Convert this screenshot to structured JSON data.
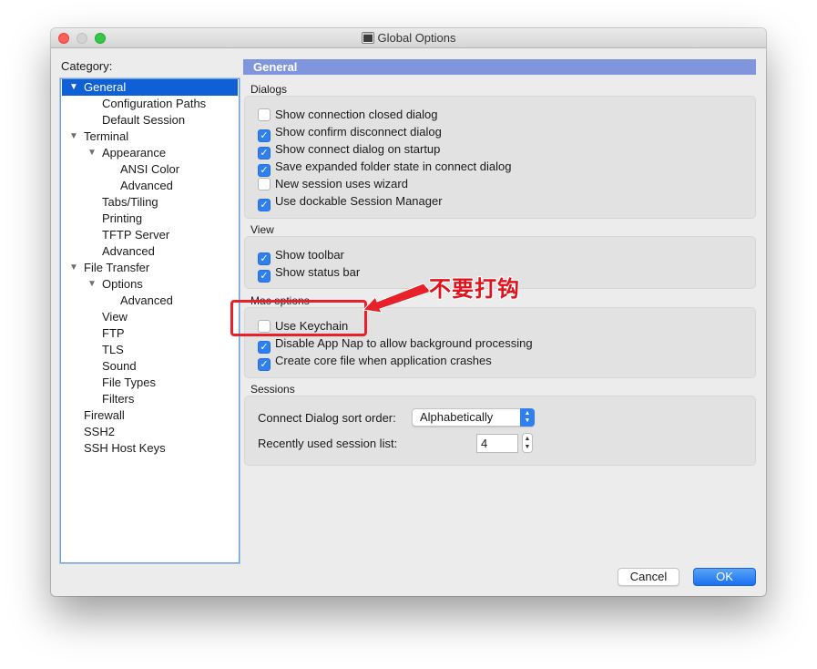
{
  "window": {
    "title": "Global Options"
  },
  "category": {
    "label": "Category:",
    "items": [
      {
        "label": "General",
        "expanded": true,
        "selected": true
      },
      {
        "label": "Configuration Paths"
      },
      {
        "label": "Default Session"
      },
      {
        "label": "Terminal",
        "expanded": true
      },
      {
        "label": "Appearance",
        "expanded": true
      },
      {
        "label": "ANSI Color"
      },
      {
        "label": "Advanced"
      },
      {
        "label": "Tabs/Tiling"
      },
      {
        "label": "Printing"
      },
      {
        "label": "TFTP Server"
      },
      {
        "label": "Advanced"
      },
      {
        "label": "File Transfer",
        "expanded": true
      },
      {
        "label": "Options",
        "expanded": true
      },
      {
        "label": "Advanced"
      },
      {
        "label": "View"
      },
      {
        "label": "FTP"
      },
      {
        "label": "TLS"
      },
      {
        "label": "Sound"
      },
      {
        "label": "File Types"
      },
      {
        "label": "Filters"
      },
      {
        "label": "Firewall"
      },
      {
        "label": "SSH2"
      },
      {
        "label": "SSH Host Keys"
      }
    ]
  },
  "content": {
    "header": "General",
    "dialogs": {
      "title": "Dialogs",
      "options": [
        {
          "label": "Show connection closed dialog",
          "checked": false
        },
        {
          "label": "Show confirm disconnect dialog",
          "checked": true
        },
        {
          "label": "Show connect dialog on startup",
          "checked": true
        },
        {
          "label": "Save expanded folder state in connect dialog",
          "checked": true
        },
        {
          "label": "New session uses wizard",
          "checked": false
        },
        {
          "label": "Use dockable Session Manager",
          "checked": true
        }
      ]
    },
    "view": {
      "title": "View",
      "options": [
        {
          "label": "Show toolbar",
          "checked": true
        },
        {
          "label": "Show status bar",
          "checked": true
        }
      ]
    },
    "mac_options": {
      "title": "Mac options",
      "options": [
        {
          "label": "Use Keychain",
          "checked": false
        },
        {
          "label": "Disable App Nap to allow background processing",
          "checked": true
        },
        {
          "label": "Create core file when application crashes",
          "checked": true
        }
      ]
    },
    "sessions": {
      "title": "Sessions",
      "sort_label": "Connect Dialog sort order:",
      "sort_value": "Alphabetically",
      "recent_label": "Recently used session list:",
      "recent_value": "4"
    }
  },
  "buttons": {
    "cancel": "Cancel",
    "ok": "OK"
  },
  "annotation": {
    "text": "不要打钩",
    "color": "#e8202a"
  }
}
